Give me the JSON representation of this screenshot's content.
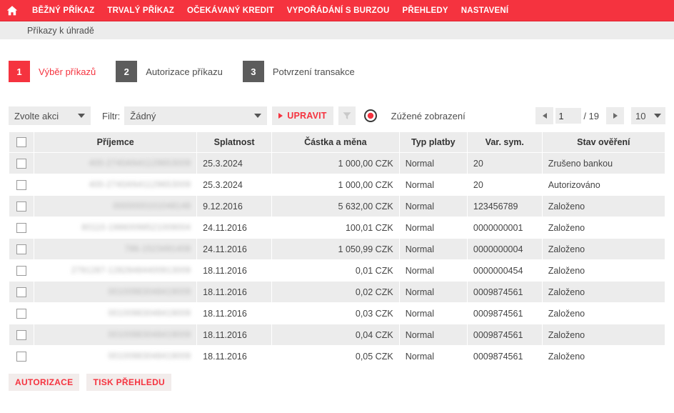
{
  "topnav": {
    "home_icon": "home-icon",
    "items": [
      {
        "label": "BĚŽNÝ PŘÍKAZ"
      },
      {
        "label": "TRVALÝ PŘÍKAZ"
      },
      {
        "label": "OČEKÁVANÝ KREDIT"
      },
      {
        "label": "VYPOŘÁDÁNÍ S BURZOU"
      },
      {
        "label": "PŘEHLEDY"
      },
      {
        "label": "NASTAVENÍ"
      }
    ],
    "accent_color": "#f5333f"
  },
  "breadcrumb": {
    "text": "Příkazy k úhradě"
  },
  "steps": [
    {
      "num": "1",
      "label": "Výběr příkazů",
      "active": true
    },
    {
      "num": "2",
      "label": "Autorizace příkazu",
      "active": false
    },
    {
      "num": "3",
      "label": "Potvrzení transakce",
      "active": false
    }
  ],
  "toolbar": {
    "action_select": "Zvolte akci",
    "filter_label": "Filtr:",
    "filter_select": "Žádný",
    "edit_button": "UPRAVIT",
    "funnel_icon": "funnel-icon",
    "target_icon": "target-icon",
    "narrow_view_label": "Zúžené zobrazení"
  },
  "pagination": {
    "page_value": "1",
    "total_pages": "/ 19",
    "page_size": "10",
    "prev_icon": "arrow-left-icon",
    "next_icon": "arrow-right-icon"
  },
  "table": {
    "headers": [
      "",
      "Příjemce",
      "Splatnost",
      "Částka a měna",
      "Typ platby",
      "Var. sym.",
      "Stav ověření"
    ],
    "rows": [
      {
        "recipient": "400-2740AN41129653009",
        "due": "25.3.2024",
        "amount": "1 000,00 CZK",
        "type": "Normal",
        "vs": "20",
        "state": "Zrušeno bankou"
      },
      {
        "recipient": "400-2740AN41129653009",
        "due": "25.3.2024",
        "amount": "1 000,00 CZK",
        "type": "Normal",
        "vs": "20",
        "state": "Autorizováno"
      },
      {
        "recipient": "0000000101048148",
        "due": "9.12.2016",
        "amount": "5 632,00 CZK",
        "type": "Normal",
        "vs": "123456789",
        "state": "Založeno"
      },
      {
        "recipient": "80110-19860098521009004",
        "due": "24.11.2016",
        "amount": "100,01 CZK",
        "type": "Normal",
        "vs": "0000000001",
        "state": "Založeno"
      },
      {
        "recipient": "786-1523491408",
        "due": "24.11.2016",
        "amount": "1 050,99 CZK",
        "type": "Normal",
        "vs": "0000000004",
        "state": "Založeno"
      },
      {
        "recipient": "2791287-12828484400913009",
        "due": "18.11.2016",
        "amount": "0,01 CZK",
        "type": "Normal",
        "vs": "0000000454",
        "state": "Založeno"
      },
      {
        "recipient": "00100983048419009",
        "due": "18.11.2016",
        "amount": "0,02 CZK",
        "type": "Normal",
        "vs": "0009874561",
        "state": "Založeno"
      },
      {
        "recipient": "00100983048419009",
        "due": "18.11.2016",
        "amount": "0,03 CZK",
        "type": "Normal",
        "vs": "0009874561",
        "state": "Založeno"
      },
      {
        "recipient": "00100983048419009",
        "due": "18.11.2016",
        "amount": "0,04 CZK",
        "type": "Normal",
        "vs": "0009874561",
        "state": "Založeno"
      },
      {
        "recipient": "00100983048419009",
        "due": "18.11.2016",
        "amount": "0,05 CZK",
        "type": "Normal",
        "vs": "0009874561",
        "state": "Založeno"
      }
    ]
  },
  "footer_buttons": [
    {
      "label": "AUTORIZACE"
    },
    {
      "label": "TISK PŘEHLEDU"
    }
  ]
}
